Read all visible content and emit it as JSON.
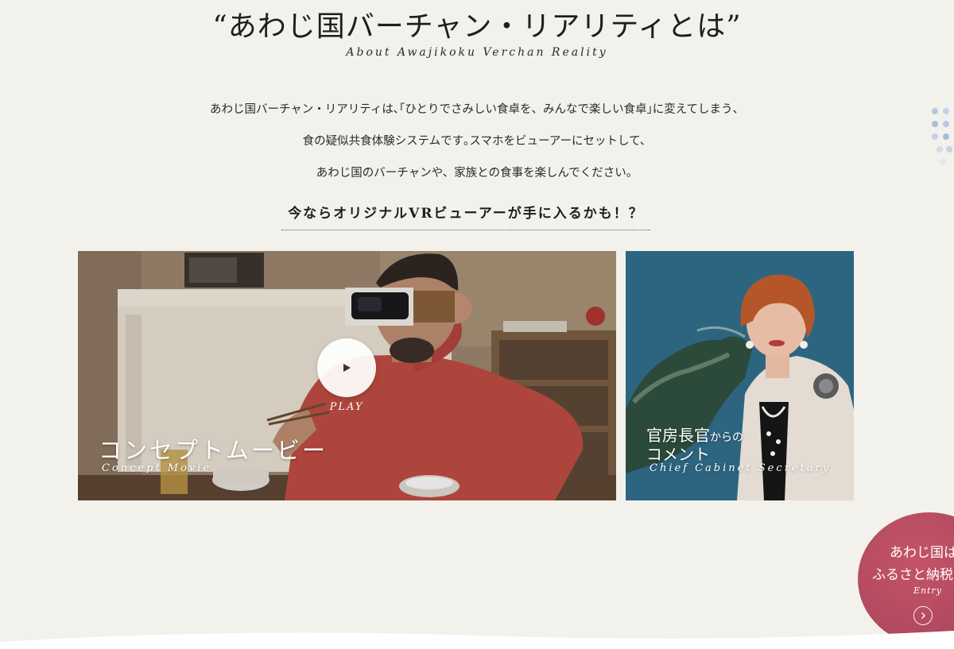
{
  "header": {
    "title": "“あわじ国バーチャン・リアリティとは”",
    "subtitle": "About Awajikoku Verchan Reality"
  },
  "intro": {
    "lines": [
      "あわじ国バーチャン・リアリティは､｢ひとりでさみしい食卓を、みんなで楽しい食卓｣に変えてしまう、",
      "食の疑似共食体験システムです｡スマホをビューアーにセットして、",
      "あわじ国のバーチャンや、家族との食事を楽しんでください。"
    ]
  },
  "vr_heading": "今ならオリジナルVRビューアーが手に入るかも！？",
  "cards": {
    "movie": {
      "play_label": "PLAY",
      "title": "コンセプトムービー",
      "subtitle": "Concept Movie"
    },
    "secretary": {
      "title_main_1": "官房長官",
      "title_small": "からの",
      "title_main_2": "コメント",
      "subtitle": "Chief Cabinet Secretary"
    }
  },
  "entry": {
    "line1": "あわじ国は",
    "line2": "ふるさと納税",
    "label": "Entry"
  },
  "colors": {
    "background": "#f3f1ec",
    "entry_badge": "#b44a60",
    "dots": "#a9bcdc"
  }
}
